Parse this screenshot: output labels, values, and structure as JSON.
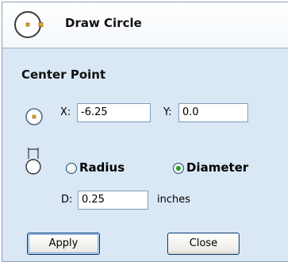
{
  "panel": {
    "title": "Draw Circle",
    "icon": "circle-tool-icon"
  },
  "center_point": {
    "heading": "Center Point",
    "icon": "center-point-icon",
    "x_label": "X:",
    "x_value": "-6.25",
    "y_label": "Y:",
    "y_value": "0.0"
  },
  "size": {
    "icon": "diameter-measure-icon",
    "radius_label": "Radius",
    "diameter_label": "Diameter",
    "selected": "Diameter",
    "d_label": "D:",
    "d_value": "0.25",
    "units": "inches"
  },
  "buttons": {
    "apply": "Apply",
    "close": "Close"
  },
  "colors": {
    "panel_bg": "#dae7f5",
    "header_bg": "#ffffff",
    "radio_selected": "#21a121",
    "tool_handle": "#e8a21c"
  }
}
